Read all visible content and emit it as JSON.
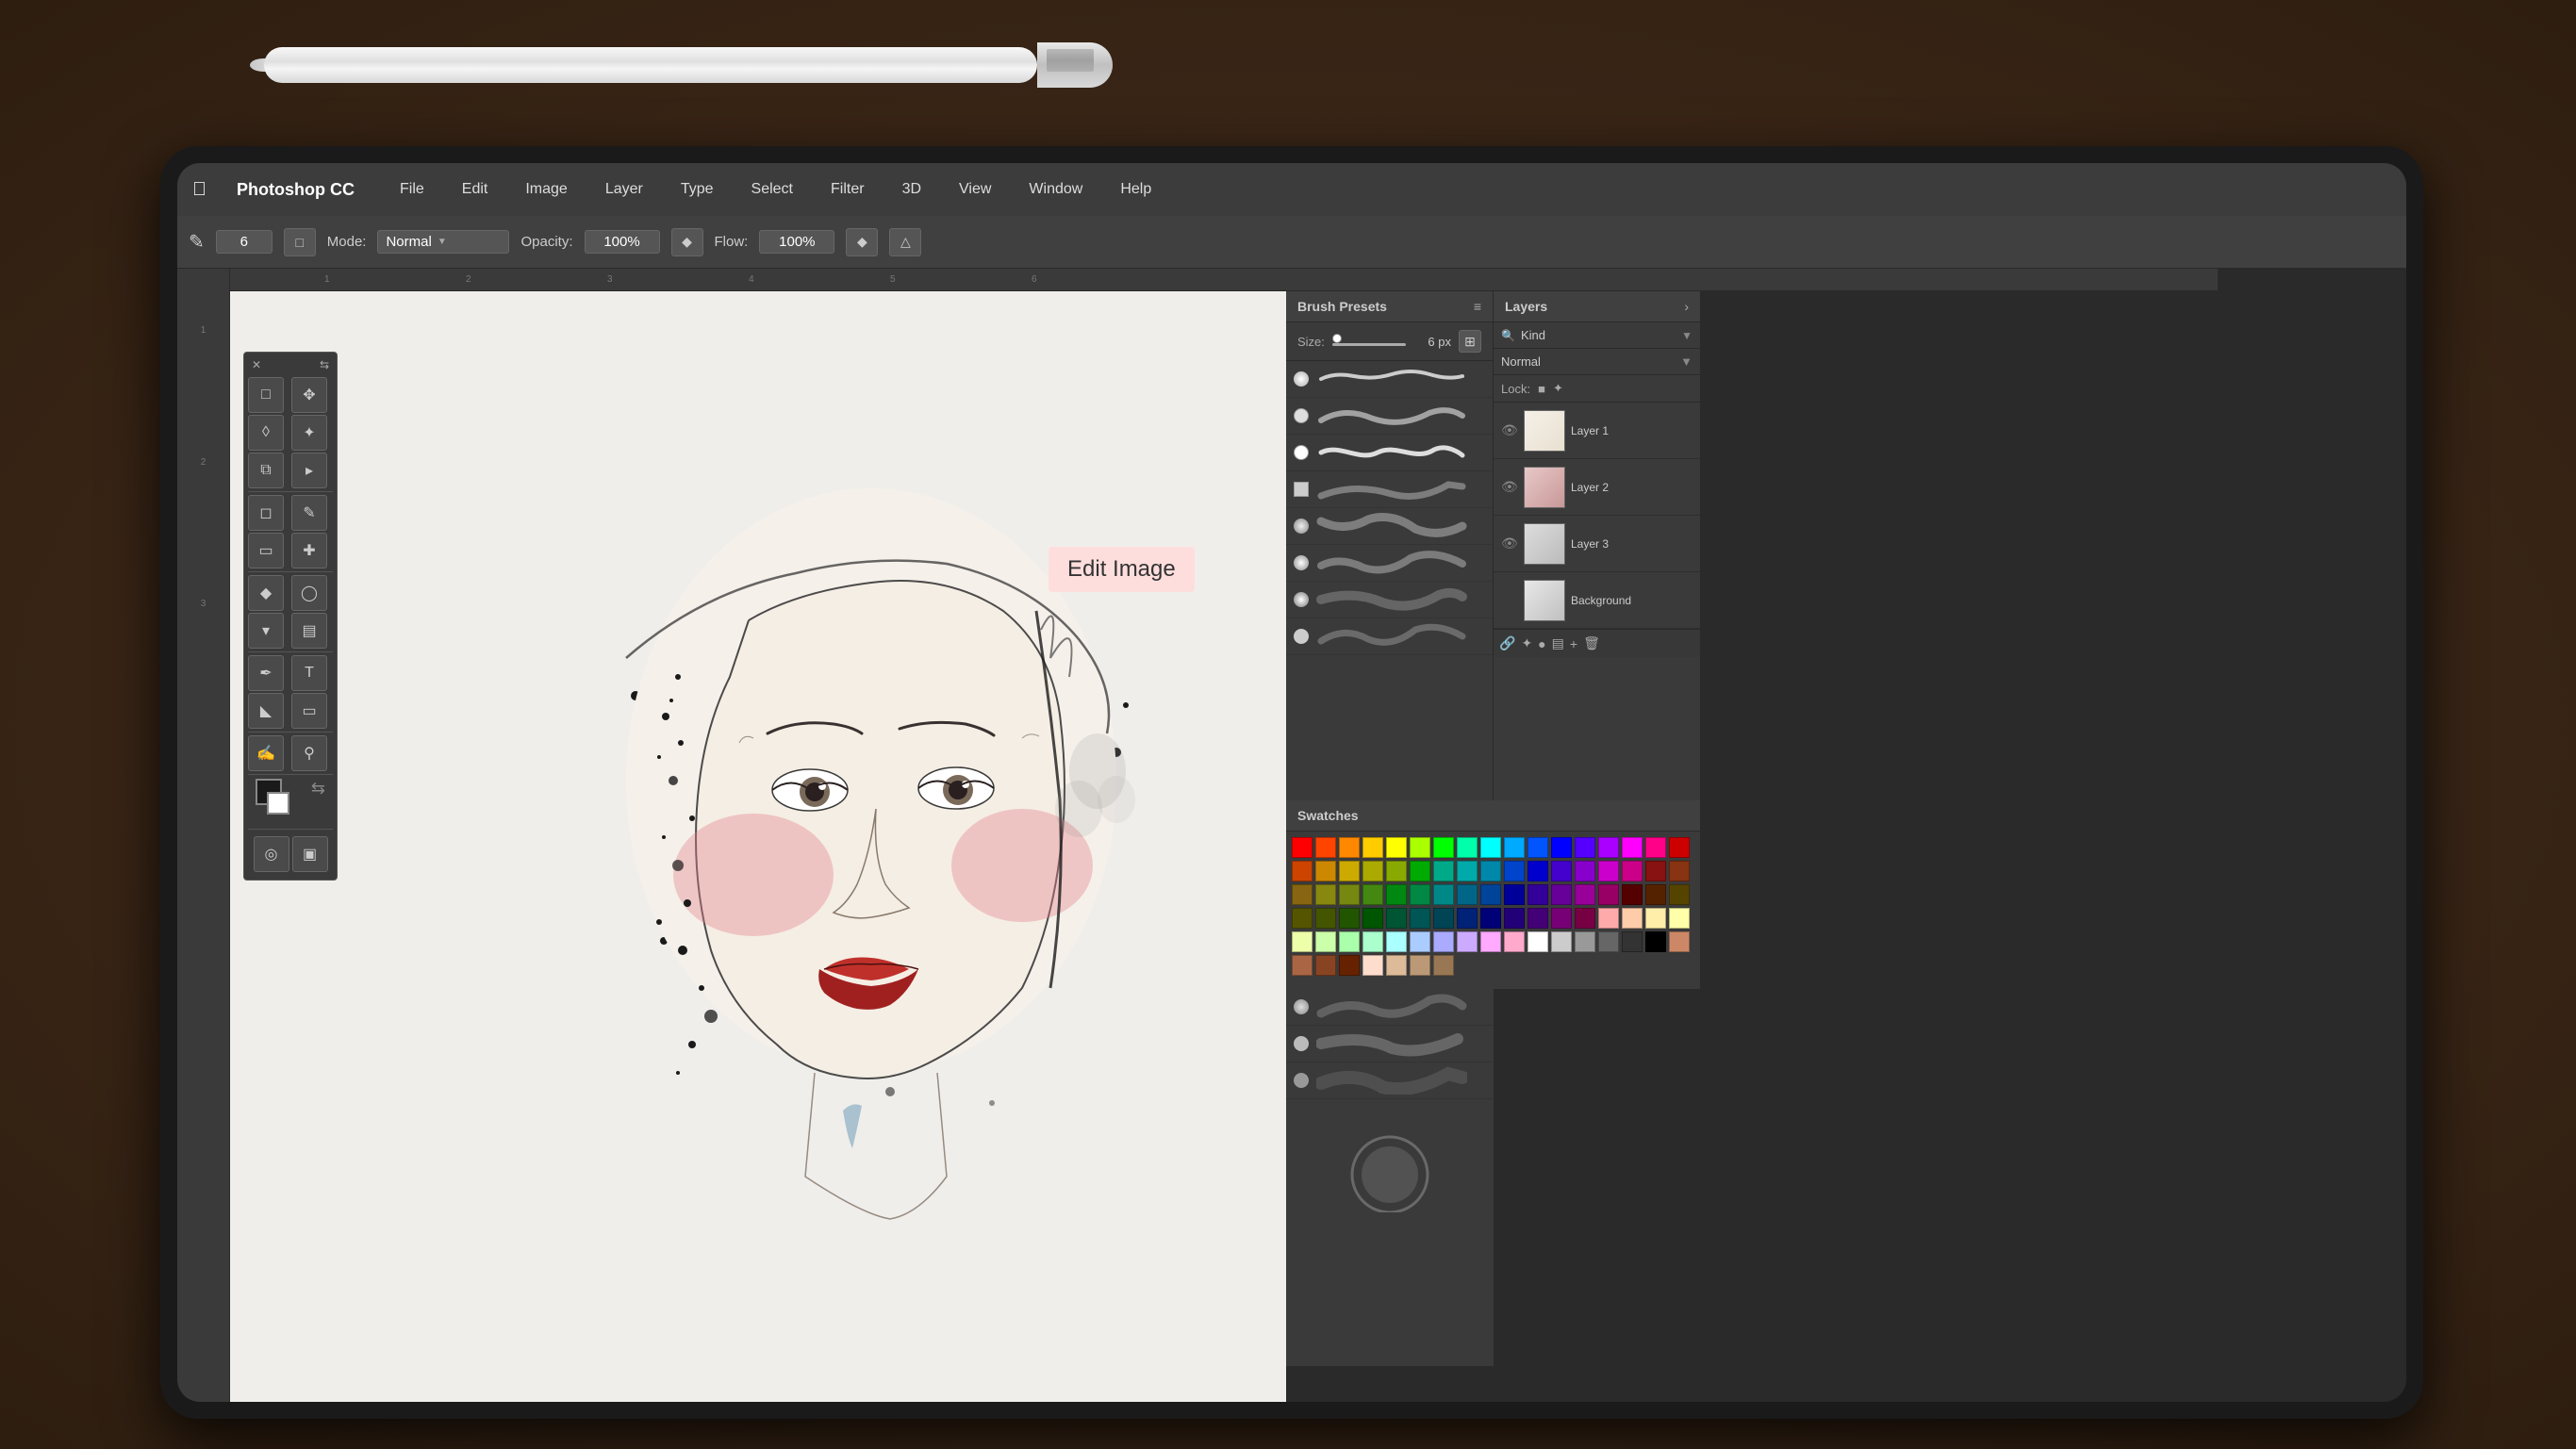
{
  "app": {
    "name": "Photoshop CC",
    "menu_items": [
      "File",
      "Edit",
      "Image",
      "Layer",
      "Type",
      "Select",
      "Filter",
      "3D",
      "View",
      "Window",
      "Help"
    ]
  },
  "toolbar": {
    "brush_size": "6",
    "mode_label": "Mode:",
    "mode_value": "Normal",
    "opacity_label": "Opacity:",
    "opacity_value": "100%",
    "flow_label": "Flow:",
    "flow_value": "100%"
  },
  "brush_presets": {
    "title": "Brush Presets",
    "size_label": "Size:",
    "size_value": "6 px"
  },
  "layers": {
    "title": "Layers",
    "search_placeholder": "Kind",
    "mode_value": "Normal",
    "lock_label": "Lock:"
  },
  "swatches": {
    "title": "Swatches",
    "colors": [
      "#ff0000",
      "#ff4400",
      "#ff8800",
      "#ffcc00",
      "#ffff00",
      "#aaff00",
      "#00ff00",
      "#00ffaa",
      "#00ffff",
      "#00aaff",
      "#0055ff",
      "#0000ff",
      "#5500ff",
      "#aa00ff",
      "#ff00ff",
      "#ff0088",
      "#cc0000",
      "#cc4400",
      "#cc8800",
      "#ccaa00",
      "#aaaa00",
      "#88aa00",
      "#00aa00",
      "#00aa88",
      "#00aaaa",
      "#0088aa",
      "#0044cc",
      "#0000cc",
      "#4400cc",
      "#8800cc",
      "#cc00cc",
      "#cc0088",
      "#881111",
      "#883311",
      "#886611",
      "#888811",
      "#778811",
      "#448811",
      "#008811",
      "#008844",
      "#008888",
      "#006688",
      "#004499",
      "#000099",
      "#330099",
      "#660099",
      "#990099",
      "#990066",
      "#550000",
      "#552200",
      "#554400",
      "#555500",
      "#445500",
      "#225500",
      "#005500",
      "#005533",
      "#005555",
      "#004455",
      "#002277",
      "#000077",
      "#220077",
      "#440077",
      "#770077",
      "#770044",
      "#ffaaaa",
      "#ffccaa",
      "#ffeeaa",
      "#ffffaa",
      "#eeffaa",
      "#ccffaa",
      "#aaffaa",
      "#aaffcc",
      "#aaffff",
      "#aaccff",
      "#aaaaff",
      "#ccaaff",
      "#ffaaff",
      "#ffaacc",
      "#ffffff",
      "#cccccc",
      "#999999",
      "#666666",
      "#333333",
      "#000000",
      "#cc8866",
      "#aa6644",
      "#884422",
      "#662200",
      "#ffddcc",
      "#ddbb99",
      "#bb9977",
      "#997755"
    ]
  },
  "edit_image": {
    "label": "Edit Image"
  },
  "canvas": {
    "width": "1120",
    "height": "880"
  }
}
